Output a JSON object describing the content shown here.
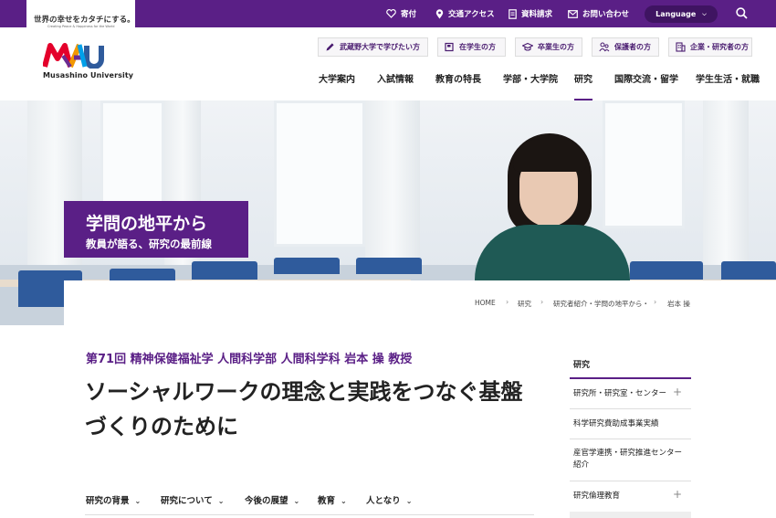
{
  "brand": {
    "tagline": "世界の幸せをカタチにする。",
    "tagline_en": "Creating Peace & Happiness for the World",
    "name": "Musashino University",
    "colors": {
      "primary": "#5a1f86",
      "dark": "#3f1462",
      "logo_red": "#e4002b",
      "logo_purple": "#6b2c91",
      "logo_blue": "#2f5b9c"
    }
  },
  "utility_nav": [
    {
      "label": "寄付",
      "icon": "donation-icon"
    },
    {
      "label": "交通アクセス",
      "icon": "map-pin-icon"
    },
    {
      "label": "資料請求",
      "icon": "document-icon"
    },
    {
      "label": "お問い合わせ",
      "icon": "mail-icon"
    }
  ],
  "language": {
    "label": "Language"
  },
  "audience_nav": [
    {
      "label": "武蔵野大学で学びたい方",
      "icon": "pencil-icon"
    },
    {
      "label": "在学生の方",
      "icon": "student-icon"
    },
    {
      "label": "卒業生の方",
      "icon": "graduation-cap-icon"
    },
    {
      "label": "保護者の方",
      "icon": "parents-icon"
    },
    {
      "label": "企業・研究者の方",
      "icon": "building-icon"
    }
  ],
  "main_nav": [
    "大学案内",
    "入試情報",
    "教育の特長",
    "学部・大学院",
    "研究",
    "国際交流・留学",
    "学生生活・就職"
  ],
  "main_nav_active": "研究",
  "hero": {
    "title": "学問の地平から",
    "subtitle": "教員が語る、研究の最前線"
  },
  "breadcrumb": [
    "HOME",
    "研究",
    "研究者紹介・学問の地平から・",
    "岩本 操"
  ],
  "article": {
    "lead": "第71回 精神保健福祉学 人間科学部 人間科学科 岩本 操 教授",
    "title": "ソーシャルワークの理念と実践をつなぐ基盤づくりのために"
  },
  "article_tabs": [
    "研究の背景",
    "研究について",
    "今後の展望",
    "教育",
    "人となり"
  ],
  "sidebar": {
    "heading": "研究",
    "items": [
      {
        "label": "研究所・研究室・センター",
        "expandable": true
      },
      {
        "label": "科学研究費助成事業実績",
        "expandable": false
      },
      {
        "label": "産官学連携・研究推進センター紹介",
        "expandable": false
      },
      {
        "label": "研究倫理教育",
        "expandable": true
      }
    ]
  }
}
